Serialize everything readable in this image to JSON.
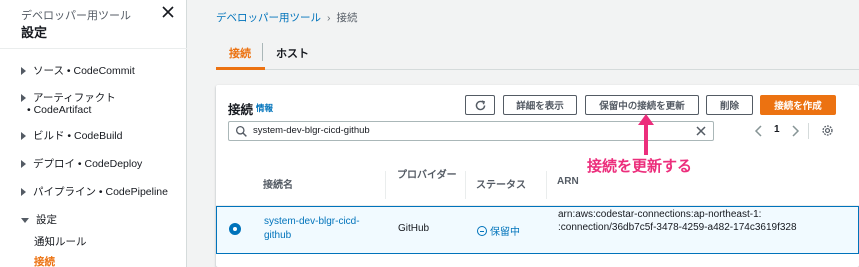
{
  "sidebar": {
    "subtitle": "デベロッパー用ツール",
    "title": "設定",
    "items": [
      {
        "label": "ソース • CodeCommit"
      },
      {
        "label": "アーティファクト",
        "cont": "• CodeArtifact"
      },
      {
        "label": "ビルド • CodeBuild"
      },
      {
        "label": "デプロイ • CodeDeploy"
      },
      {
        "label": "パイプライン • CodePipeline"
      },
      {
        "label": "設定"
      }
    ],
    "sub_items": [
      {
        "label": "通知ルール"
      },
      {
        "label": "接続"
      }
    ]
  },
  "breadcrumb": {
    "parent": "デベロッパー用ツール",
    "current": "接続"
  },
  "tabs": [
    {
      "label": "接続"
    },
    {
      "label": "ホスト"
    }
  ],
  "panel": {
    "title": "接続",
    "info": "情報",
    "buttons": {
      "details": "詳細を表示",
      "update": "保留中の接続を更新",
      "delete": "削除",
      "create": "接続を作成"
    },
    "search": {
      "value": "system-dev-blgr-cicd-github"
    },
    "pager": {
      "page": "1"
    },
    "columns": [
      "接続名",
      "プロバイダー",
      "ステータス",
      "ARN"
    ],
    "rows": [
      {
        "name": "system-dev-blgr-cicd-github",
        "provider": "GitHub",
        "status": "保留中",
        "arn": "arn:aws:codestar-connections:ap-northeast-1:            :connection/36db7c5f-3478-4259-a482-174c3619f328"
      }
    ]
  },
  "annotation": {
    "text": "接続を更新する",
    "color": "#ec2e7c"
  },
  "colors": {
    "accent": "#ec7211",
    "link": "#0073bb"
  }
}
